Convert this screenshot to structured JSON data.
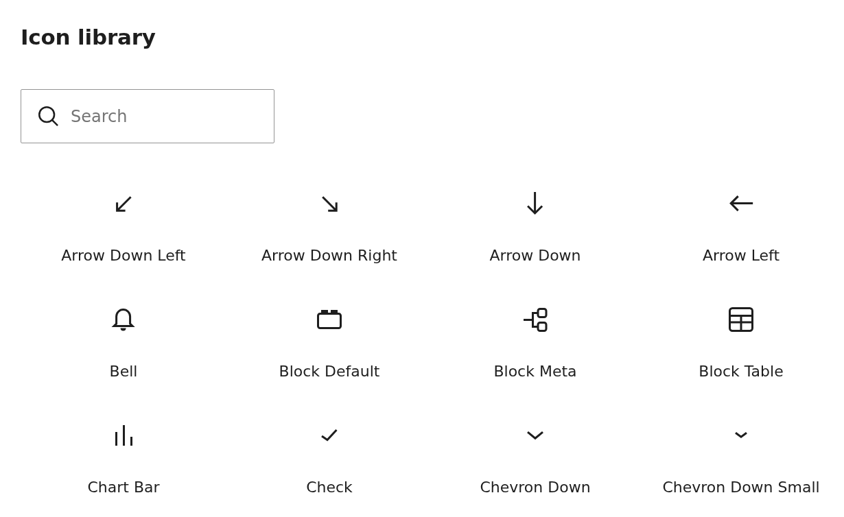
{
  "title": "Icon library",
  "search": {
    "placeholder": "Search"
  },
  "icons": [
    {
      "label": "Arrow Down Left",
      "kind": "arrowDownLeft"
    },
    {
      "label": "Arrow Down Right",
      "kind": "arrowDownRight"
    },
    {
      "label": "Arrow Down",
      "kind": "arrowDown"
    },
    {
      "label": "Arrow Left",
      "kind": "arrowLeft"
    },
    {
      "label": "Bell",
      "kind": "bell"
    },
    {
      "label": "Block Default",
      "kind": "blockDefault"
    },
    {
      "label": "Block Meta",
      "kind": "blockMeta"
    },
    {
      "label": "Block Table",
      "kind": "blockTable"
    },
    {
      "label": "Chart Bar",
      "kind": "chartBar"
    },
    {
      "label": "Check",
      "kind": "check"
    },
    {
      "label": "Chevron Down",
      "kind": "chevronDown"
    },
    {
      "label": "Chevron Down Small",
      "kind": "chevronDownSmall"
    }
  ]
}
